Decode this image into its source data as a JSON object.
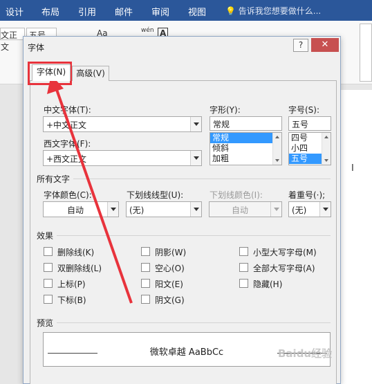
{
  "ribbon": {
    "tabs": [
      "设计",
      "布局",
      "引用",
      "邮件",
      "审阅",
      "视图"
    ],
    "tell_me": "告诉我您想要做什么...",
    "font_name": "文正文",
    "font_size": "五号",
    "text_effect": "Aa",
    "phonetic": "wén",
    "border_char": "A"
  },
  "dialog": {
    "title": "字体",
    "help": "?",
    "close": "✕",
    "tabs": {
      "font": "字体(N)",
      "advanced": "高级(V)"
    },
    "chinese_font_label": "中文字体(T):",
    "chinese_font_value": "+中文正文",
    "western_font_label": "西文字体(F):",
    "western_font_value": "+西文正文",
    "style_label": "字形(Y):",
    "style_value": "常规",
    "style_options": [
      "常规",
      "倾斜",
      "加粗"
    ],
    "size_label": "字号(S):",
    "size_value": "五号",
    "size_options": [
      "四号",
      "小四",
      "五号"
    ],
    "all_text_section": "所有文字",
    "font_color_label": "字体颜色(C):",
    "font_color_value": "自动",
    "underline_style_label": "下划线线型(U):",
    "underline_style_value": "(无)",
    "underline_color_label": "下划线颜色(I):",
    "underline_color_value": "自动",
    "emphasis_label": "着重号(·);",
    "emphasis_value": "(无)",
    "effects_section": "效果",
    "effects": {
      "strikethrough": "删除线(K)",
      "double_strikethrough": "双删除线(L)",
      "superscript": "上标(P)",
      "subscript": "下标(B)",
      "shadow": "阴影(W)",
      "outline": "空心(O)",
      "emboss": "阳文(E)",
      "engrave": "阴文(G)",
      "small_caps": "小型大写字母(M)",
      "all_caps": "全部大写字母(A)",
      "hidden": "隐藏(H)"
    },
    "preview_section": "预览",
    "preview_text": "微软卓越  AaBbCc"
  },
  "watermark": "Baidu经验",
  "colors": {
    "ribbon": "#2b579a",
    "annotation": "#e8333c",
    "selection": "#3399ff",
    "close": "#c75050"
  }
}
